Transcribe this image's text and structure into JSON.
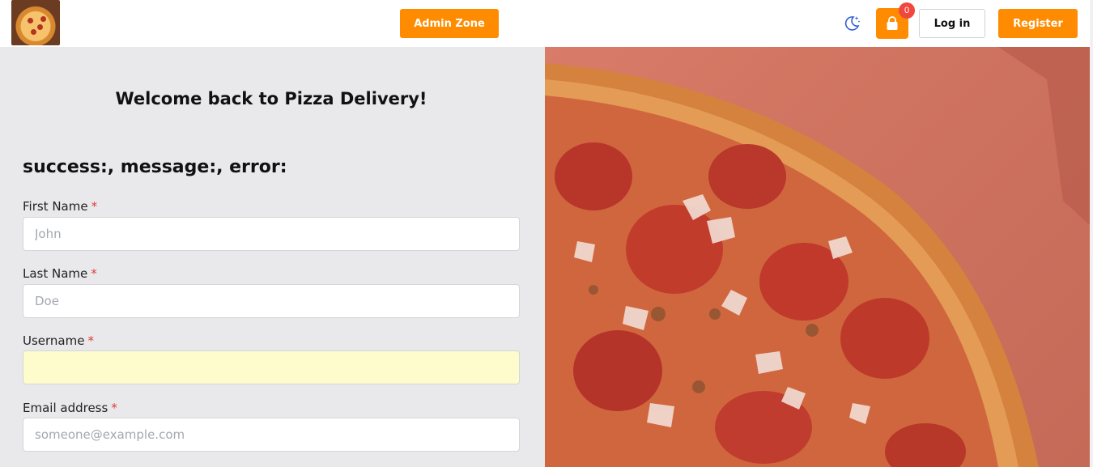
{
  "nav": {
    "admin_label": "Admin Zone",
    "cart_count": "0",
    "login_label": "Log in",
    "register_label": "Register",
    "theme_icon": "moon-stars-icon",
    "cart_icon": "shopping-bag-icon"
  },
  "form": {
    "welcome": "Welcome back to Pizza Delivery!",
    "status": "success:, message:, error:",
    "required_marker": "*",
    "fields": [
      {
        "label": "First Name",
        "placeholder": "John",
        "value": ""
      },
      {
        "label": "Last Name",
        "placeholder": "Doe",
        "value": ""
      },
      {
        "label": "Username",
        "placeholder": "",
        "value": ""
      },
      {
        "label": "Email address",
        "placeholder": "someone@example.com",
        "value": ""
      }
    ]
  },
  "colors": {
    "accent": "#ff8c00",
    "badge": "#f0473f",
    "panel_bg": "#e9e9eb",
    "required": "#e03b3b",
    "autofill_bg": "#fefbcd"
  }
}
